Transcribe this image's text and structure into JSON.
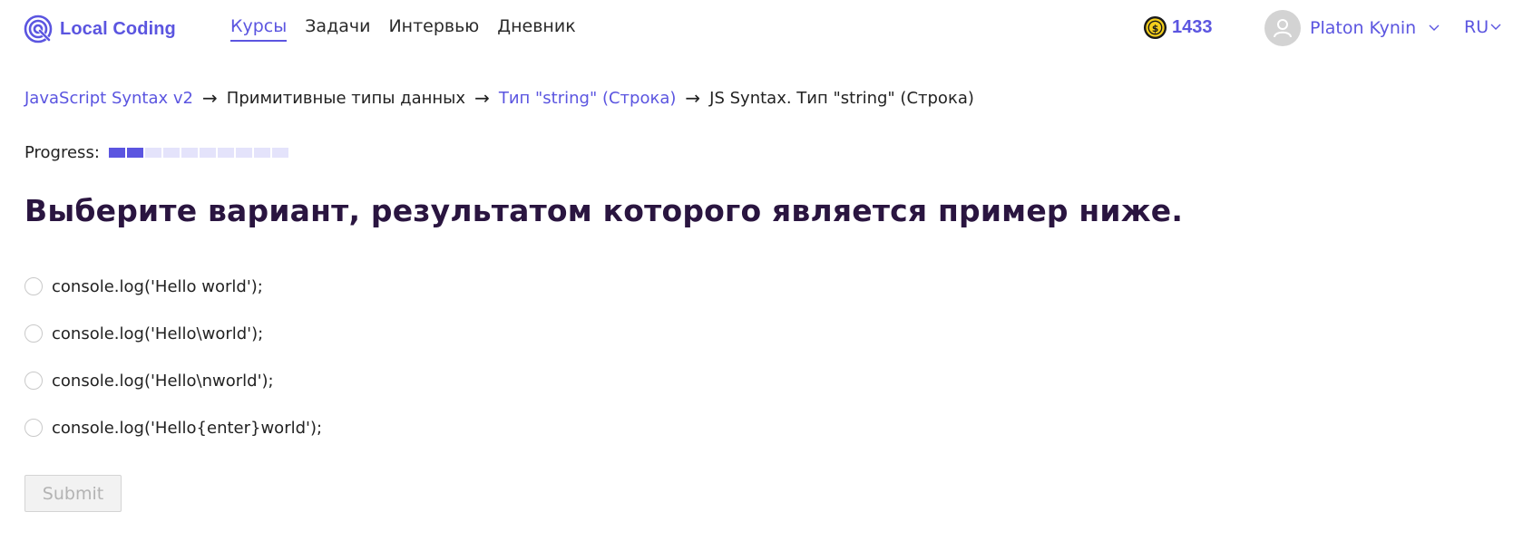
{
  "brand": {
    "name": "Local Coding",
    "logo_icon": "local-coding-logo-icon",
    "accent_color": "#5b55e0"
  },
  "nav": {
    "items": [
      {
        "label": "Курсы",
        "active": true
      },
      {
        "label": "Задачи",
        "active": false
      },
      {
        "label": "Интервью",
        "active": false
      },
      {
        "label": "Дневник",
        "active": false
      }
    ]
  },
  "coins": {
    "icon": "coin-icon",
    "count": "1433"
  },
  "user": {
    "name": "Platon Kynin",
    "avatar_icon": "user-avatar-icon"
  },
  "language": {
    "label": "RU"
  },
  "breadcrumb": {
    "items": [
      {
        "label": "JavaScript Syntax v2",
        "link": true
      },
      {
        "label": "Примитивные типы данных",
        "link": false
      },
      {
        "label": "Тип \"string\" (Строка)",
        "link": true
      },
      {
        "label": "JS Syntax. Тип \"string\" (Строка)",
        "link": false
      }
    ],
    "separator": "→"
  },
  "progress": {
    "label": "Progress:",
    "completed": 2,
    "total": 10
  },
  "question": {
    "title": "Выберите вариант, результатом которого является пример ниже.",
    "options": [
      "console.log('Hello world');",
      "console.log('Hello\\world');",
      "console.log('Hello\\nworld');",
      "console.log('Hello{enter}world');"
    ]
  },
  "submit": {
    "label": "Submit",
    "disabled": true
  }
}
